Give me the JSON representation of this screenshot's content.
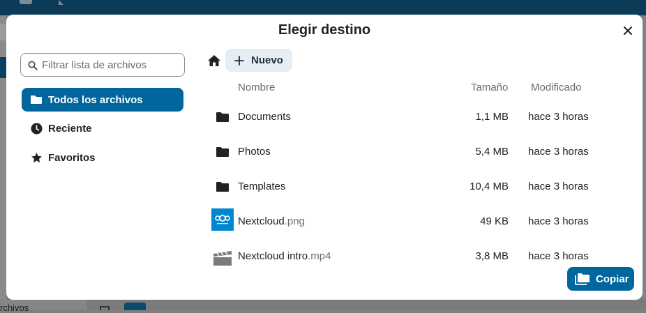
{
  "dialog": {
    "title": "Elegir destino",
    "close_label": "Cerrar"
  },
  "sidebar": {
    "filter_placeholder": "Filtrar lista de archivos",
    "items": [
      {
        "label": "Todos los archivos",
        "icon": "folder-icon",
        "active": true
      },
      {
        "label": "Reciente",
        "icon": "clock-icon",
        "active": false
      },
      {
        "label": "Favoritos",
        "icon": "star-icon",
        "active": false
      }
    ]
  },
  "toolbar": {
    "home_icon": "home-icon",
    "new_label": "Nuevo"
  },
  "table": {
    "columns": {
      "name": "Nombre",
      "size": "Tamaño",
      "modified": "Modificado"
    },
    "rows": [
      {
        "name": "Documents",
        "ext": "",
        "size": "1,1 MB",
        "modified": "hace 3 horas",
        "type": "folder"
      },
      {
        "name": "Photos",
        "ext": "",
        "size": "5,4 MB",
        "modified": "hace 3 horas",
        "type": "folder"
      },
      {
        "name": "Templates",
        "ext": "",
        "size": "10,4 MB",
        "modified": "hace 3 horas",
        "type": "folder"
      },
      {
        "name": "Nextcloud",
        "ext": ".png",
        "size": "49 KB",
        "modified": "hace 3 horas",
        "type": "image"
      },
      {
        "name": "Nextcloud intro",
        "ext": ".mp4",
        "size": "3,8 MB",
        "modified": "hace 3 horas",
        "type": "video"
      }
    ]
  },
  "actions": {
    "copy_label": "Copiar"
  },
  "background": {
    "bottom_text": "rchivos"
  },
  "colors": {
    "primary": "#00679e",
    "header": "#0b3b58",
    "overlay": "#7f7f7f"
  }
}
